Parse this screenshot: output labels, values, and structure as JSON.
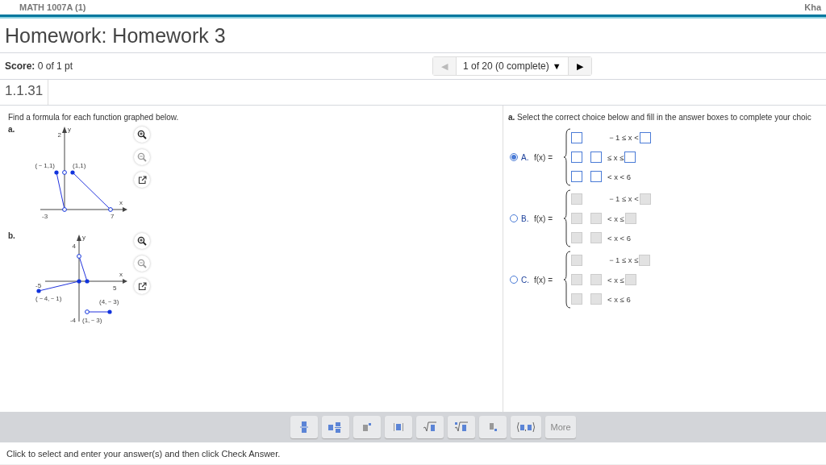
{
  "course": "MATH 1007A (1)",
  "user": "Kha",
  "title": "Homework: Homework 3",
  "score": {
    "label": "Score:",
    "value": "0 of 1 pt"
  },
  "nav": {
    "prev": "◀",
    "position": "1 of 20 (0 complete)",
    "caret": "▼",
    "next": "▶"
  },
  "question_id": "1.1.31",
  "prompt": "Find a formula for each function graphed below.",
  "graphs": [
    {
      "label": "a.",
      "x_axis": "x",
      "y_axis": "y",
      "labels": [
        "2",
        "-3",
        "7",
        "(－1,1)",
        "(1,1)"
      ]
    },
    {
      "label": "b.",
      "x_axis": "x",
      "y_axis": "y",
      "labels": [
        "4",
        "-5",
        "5",
        "-4",
        "(－4,－1)",
        "(4,－3)",
        "(1,－3)"
      ]
    }
  ],
  "instruction": "**a.** Select the correct choice below and fill in the answer boxes to complete your choic",
  "choices": [
    {
      "letter": "A.",
      "lhs": "f(x) =",
      "selected": true,
      "disabled": false,
      "rows": [
        {
          "lead": false,
          "condition": "－1 ≤ x <"
        },
        {
          "lead": true,
          "condition": "≤ x ≤"
        },
        {
          "lead": true,
          "condition": "< x < 6"
        }
      ]
    },
    {
      "letter": "B.",
      "lhs": "f(x) =",
      "selected": false,
      "disabled": true,
      "rows": [
        {
          "lead": false,
          "condition": "－1 ≤ x <"
        },
        {
          "lead": true,
          "condition": "< x ≤"
        },
        {
          "lead": true,
          "condition": "< x < 6"
        }
      ]
    },
    {
      "letter": "C.",
      "lhs": "f(x) =",
      "selected": false,
      "disabled": true,
      "rows": [
        {
          "lead": false,
          "condition": "－1 ≤ x ≤"
        },
        {
          "lead": true,
          "condition": "< x ≤"
        },
        {
          "lead": true,
          "condition": "< x ≤ 6"
        }
      ]
    }
  ],
  "tools": [
    {
      "kind": "fraction"
    },
    {
      "kind": "mixed"
    },
    {
      "kind": "exponent"
    },
    {
      "kind": "abs"
    },
    {
      "kind": "sqrt"
    },
    {
      "kind": "root"
    },
    {
      "kind": "subscript"
    },
    {
      "kind": "pair"
    },
    {
      "kind": "more",
      "label": "More"
    }
  ],
  "status": "Click to select and enter your answer(s) and then click Check Answer."
}
